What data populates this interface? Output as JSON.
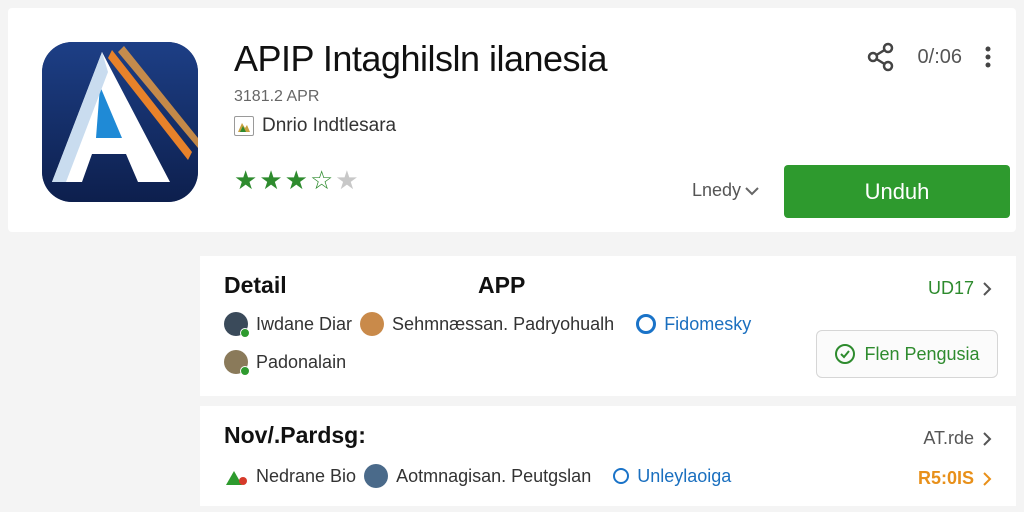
{
  "app": {
    "title": "APIP Intaghilsln ilanesia",
    "subtitle": "3181.2 APR",
    "developer": "Dnrio Indtlesara",
    "rating": 3.5,
    "stars": [
      "full",
      "full",
      "full",
      "half",
      "empty"
    ]
  },
  "top_actions": {
    "count": "0/:06",
    "share_icon": "share-icon",
    "more_icon": "more-vert-icon"
  },
  "language_select": "Lnedy",
  "install_button": "Unduh",
  "details": {
    "title": "Detail",
    "mid_label": "APP",
    "link_label": "UD17",
    "row1": {
      "person1": "Iwdane Diar",
      "person2": "Sehmnæssan. Padryohualh",
      "tag": "Fidomesky"
    },
    "row2": {
      "person": "Padonalain"
    },
    "action_button": "Flen Pengusia"
  },
  "news": {
    "title": "Nov/.Pardsg:",
    "link_label": "AT.rde",
    "row1": {
      "item1": "Nedrane Bio",
      "item2": "Aotmnagisan. Peutgslan",
      "tag": "Unleylaoiga"
    },
    "link2_label": "R5:0IS"
  },
  "colors": {
    "accent_green": "#2e9a2e",
    "link_blue": "#1a6fbf",
    "orange": "#e8901a",
    "icon_bg": "#13295f"
  }
}
